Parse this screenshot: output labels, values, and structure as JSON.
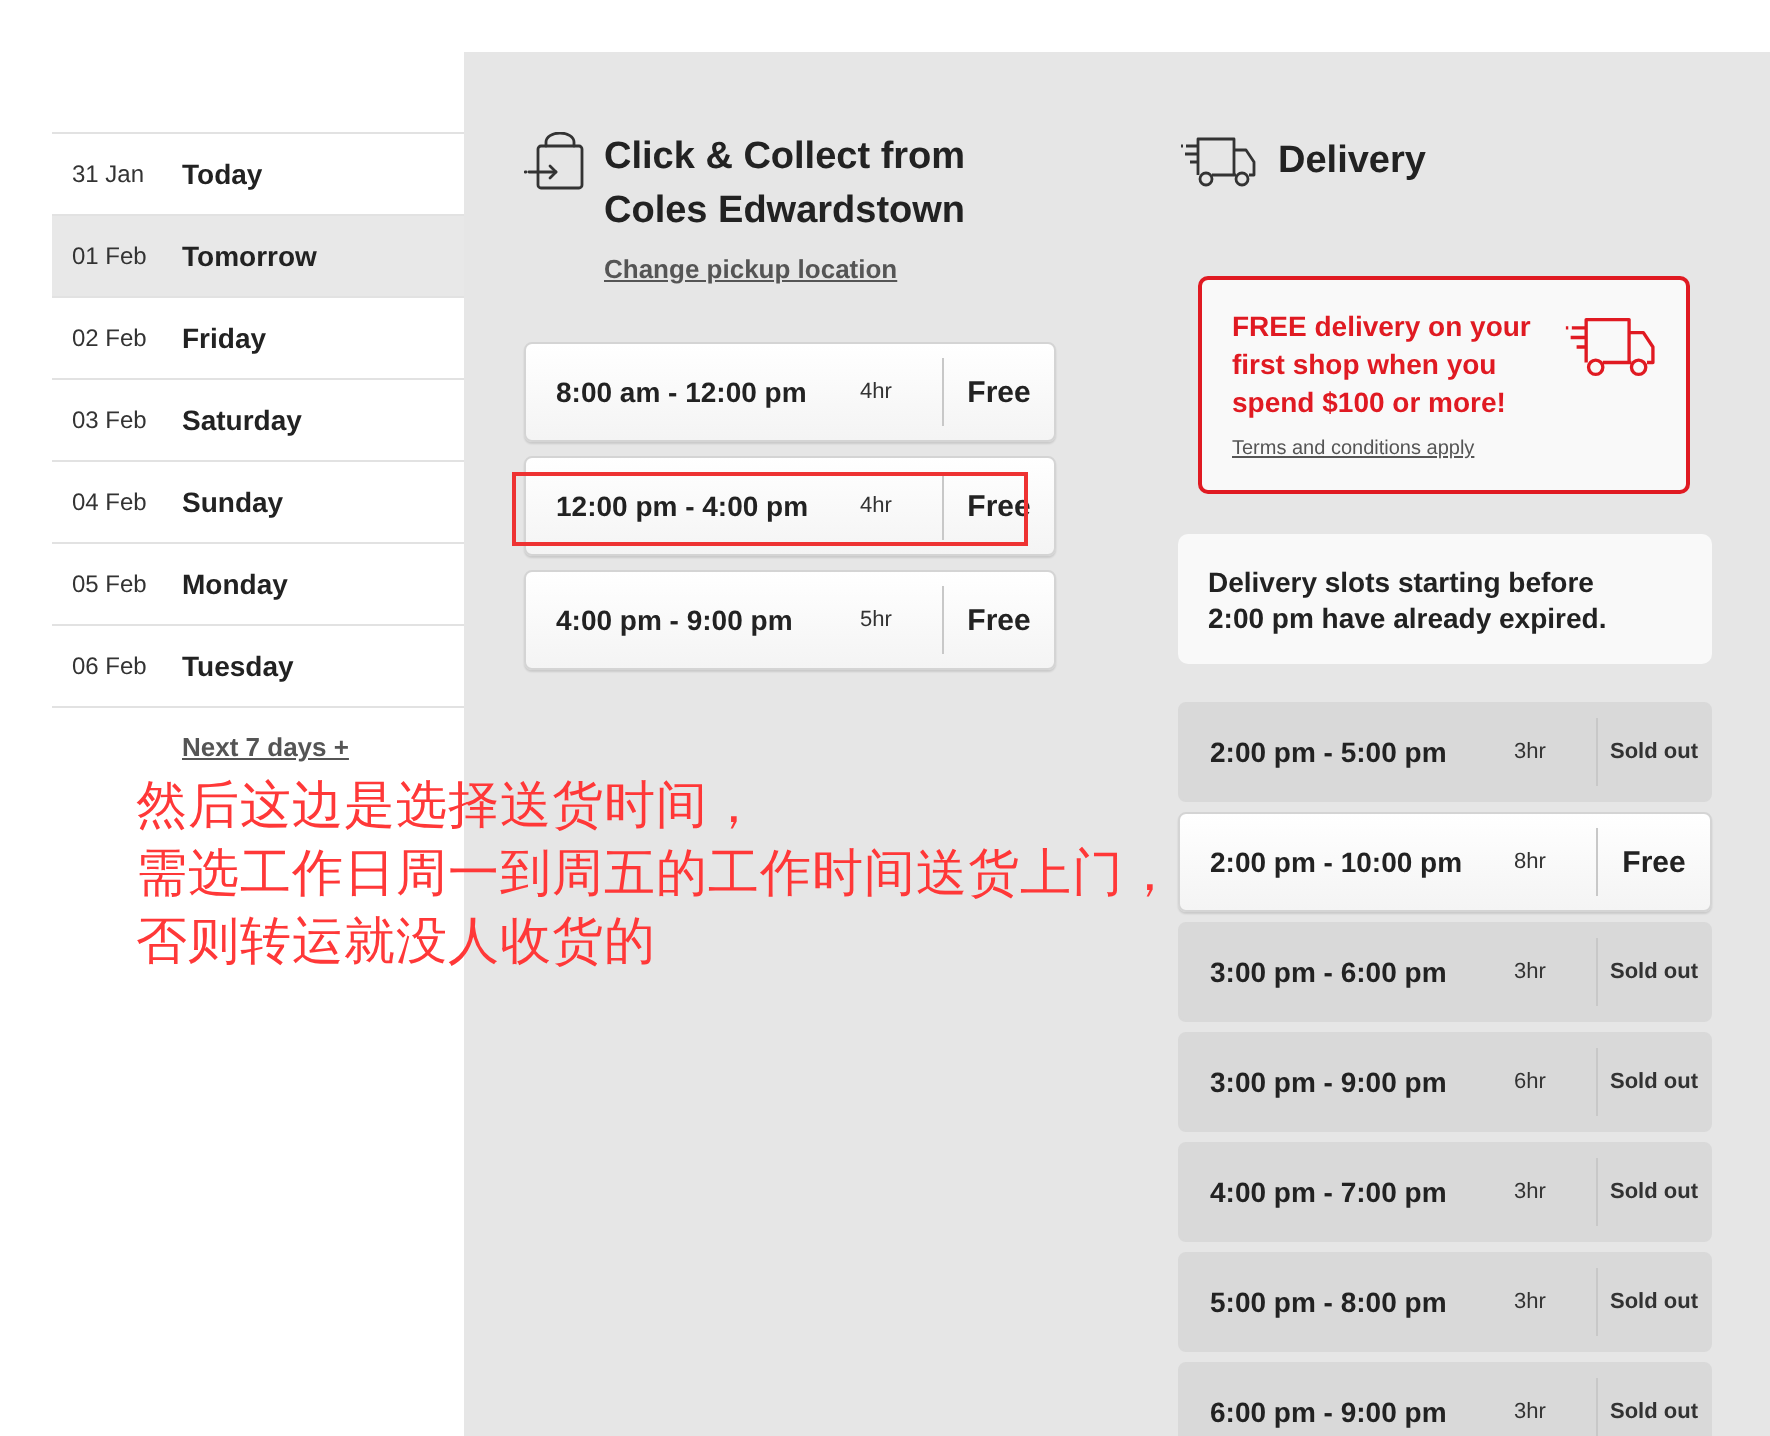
{
  "dates": [
    {
      "date": "31 Jan",
      "day": "Today",
      "selected": false
    },
    {
      "date": "01 Feb",
      "day": "Tomorrow",
      "selected": true
    },
    {
      "date": "02 Feb",
      "day": "Friday",
      "selected": false
    },
    {
      "date": "03 Feb",
      "day": "Saturday",
      "selected": false
    },
    {
      "date": "04 Feb",
      "day": "Sunday",
      "selected": false
    },
    {
      "date": "05 Feb",
      "day": "Monday",
      "selected": false
    },
    {
      "date": "06 Feb",
      "day": "Tuesday",
      "selected": false
    }
  ],
  "next_days_link": "Next 7 days +",
  "click_collect": {
    "title": "Click & Collect from Coles Edwardstown",
    "change_link": "Change pickup location",
    "slots": [
      {
        "time": "8:00 am - 12:00 pm",
        "duration": "4hr",
        "price": "Free",
        "available": true,
        "highlighted": false
      },
      {
        "time": "12:00 pm - 4:00 pm",
        "duration": "4hr",
        "price": "Free",
        "available": true,
        "highlighted": true
      },
      {
        "time": "4:00 pm - 9:00 pm",
        "duration": "5hr",
        "price": "Free",
        "available": true,
        "highlighted": false
      }
    ]
  },
  "delivery": {
    "title": "Delivery",
    "promo": {
      "text": "FREE delivery on your first shop when you spend $100 or more!",
      "terms": "Terms and conditions apply"
    },
    "notice": "Delivery slots starting before 2:00 pm have already expired.",
    "slots": [
      {
        "time": "2:00 pm - 5:00 pm",
        "duration": "3hr",
        "price": "Sold out",
        "available": false
      },
      {
        "time": "2:00 pm - 10:00 pm",
        "duration": "8hr",
        "price": "Free",
        "available": true
      },
      {
        "time": "3:00 pm - 6:00 pm",
        "duration": "3hr",
        "price": "Sold out",
        "available": false
      },
      {
        "time": "3:00 pm - 9:00 pm",
        "duration": "6hr",
        "price": "Sold out",
        "available": false
      },
      {
        "time": "4:00 pm - 7:00 pm",
        "duration": "3hr",
        "price": "Sold out",
        "available": false
      },
      {
        "time": "5:00 pm - 8:00 pm",
        "duration": "3hr",
        "price": "Sold out",
        "available": false
      },
      {
        "time": "6:00 pm - 9:00 pm",
        "duration": "3hr",
        "price": "Sold out",
        "available": false
      }
    ]
  },
  "annotation": {
    "lines": [
      "然后这边是选择送货时间，",
      "需选工作日周一到周五的工作时间送货上门，",
      "否则转运就没人收货的"
    ]
  }
}
